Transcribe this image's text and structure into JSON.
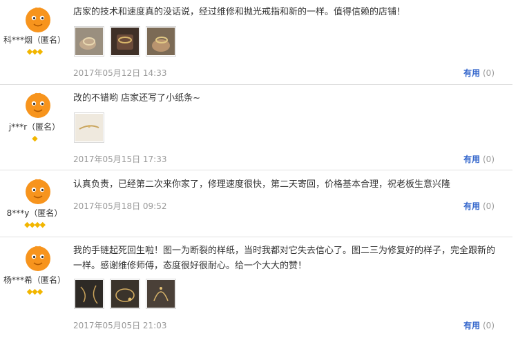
{
  "reviews": [
    {
      "user": "科***烟（匿名）",
      "level_stars": "◆◆◆",
      "content": "店家的技术和速度真的没话说，经过维修和抛光戒指和新的一样。值得信赖的店铺！",
      "photo_count": 3,
      "date": "2017年05月12日 14:33",
      "helpful_label": "有用",
      "helpful_count": "(0)"
    },
    {
      "user": "j***r（匿名）",
      "level_stars": "◆",
      "content": "改的不错哟 店家还写了小纸条~",
      "photo_count": 1,
      "date": "2017年05月15日 17:33",
      "helpful_label": "有用",
      "helpful_count": "(0)"
    },
    {
      "user": "8***y（匿名）",
      "level_stars": "◆◆◆◆",
      "content": "认真负责，已经第二次来你家了，修理速度很快，第二天寄回，价格基本合理，祝老板生意兴隆",
      "photo_count": 0,
      "date": "2017年05月18日 09:52",
      "helpful_label": "有用",
      "helpful_count": "(0)"
    },
    {
      "user": "杨***希（匿名）",
      "level_stars": "◆◆◆",
      "content": "我的手链起死回生啦！图一为断裂的样纸，当时我都对它失去信心了。图二三为修复好的样子，完全跟新的一样。感谢维修师傅，态度很好很耐心。给一个大大的赞！",
      "photo_count": 3,
      "date": "2017年05月05日 21:03",
      "helpful_label": "有用",
      "helpful_count": "(0)"
    }
  ],
  "colors": {
    "avatar": "#f7941d",
    "star": "#f2b600",
    "link": "#3366cc",
    "muted": "#999999",
    "divider": "#e0e0e0"
  }
}
